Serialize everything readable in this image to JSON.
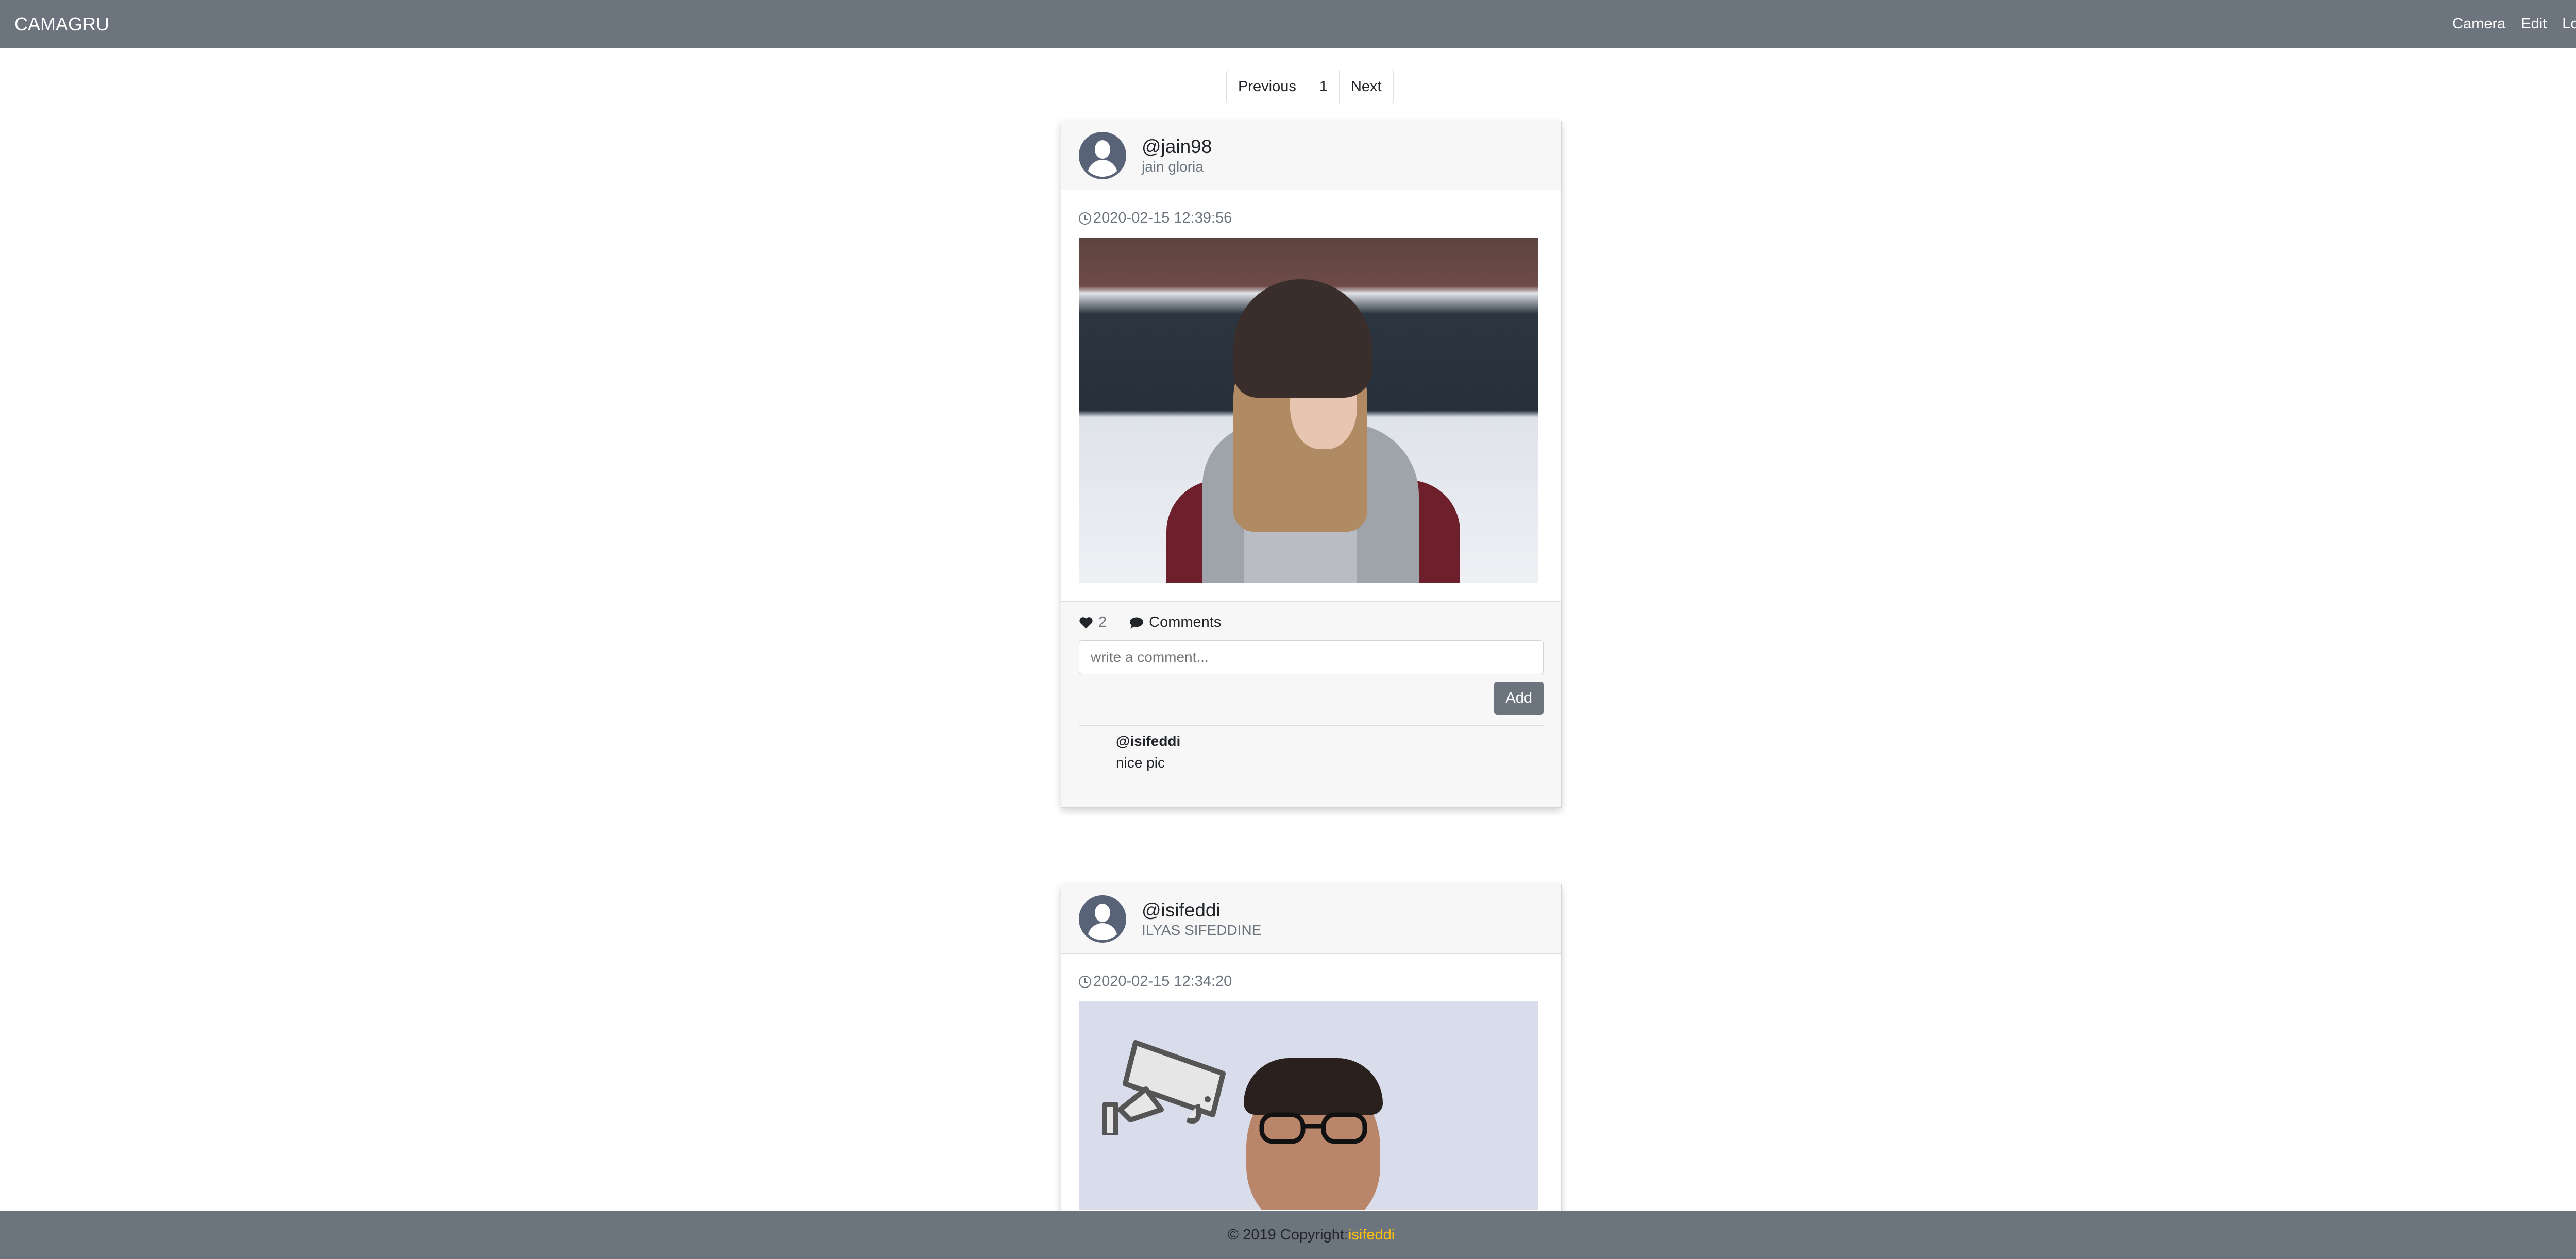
{
  "navbar": {
    "brand": "CAMAGRU",
    "links": [
      "Camera",
      "Edit",
      "Logout"
    ]
  },
  "pagination": {
    "prev": "Previous",
    "page": "1",
    "next": "Next"
  },
  "posts": [
    {
      "username": "@jain98",
      "fullname": "jain gloria",
      "timestamp": "2020-02-15 12:39:56",
      "likes": "2",
      "comments_label": "Comments",
      "comment_placeholder": "write a comment...",
      "add_label": "Add",
      "comments": [
        {
          "user": "@isifeddi",
          "text": "nice pic"
        }
      ]
    },
    {
      "username": "@isifeddi",
      "fullname": "ILYAS SIFEDDINE",
      "timestamp": "2020-02-15 12:34:20"
    }
  ],
  "footer": {
    "text": "© 2019 Copyright:",
    "author": "isifeddi"
  },
  "colors": {
    "navbar": "#6c757d",
    "accent": "#ffc107"
  }
}
